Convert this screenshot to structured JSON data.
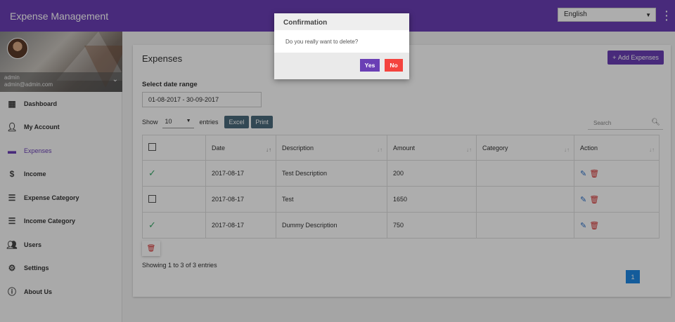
{
  "app": {
    "title": "Expense Management"
  },
  "header": {
    "language": "English"
  },
  "profile": {
    "name": "admin",
    "email": "admin@admin.com"
  },
  "sidebar": {
    "items": [
      {
        "label": "Dashboard",
        "icon": "dashboard-icon"
      },
      {
        "label": "My Account",
        "icon": "person-icon"
      },
      {
        "label": "Expenses",
        "icon": "card-icon",
        "active": true
      },
      {
        "label": "Income",
        "icon": "dollar-icon"
      },
      {
        "label": "Expense Category",
        "icon": "list-icon"
      },
      {
        "label": "Income Category",
        "icon": "list-icon"
      },
      {
        "label": "Users",
        "icon": "users-icon"
      },
      {
        "label": "Settings",
        "icon": "settings-icon"
      },
      {
        "label": "About Us",
        "icon": "info-icon"
      }
    ]
  },
  "main": {
    "title": "Expenses",
    "add_button": "Add Expenses",
    "date_label": "Select date range",
    "date_value": "01-08-2017 - 30-09-2017",
    "show_label": "Show",
    "entries_value": "10",
    "entries_label": "entries",
    "excel_label": "Excel",
    "print_label": "Print",
    "search_placeholder": "Search",
    "table": {
      "headers": [
        "Date",
        "Description",
        "Amount",
        "Category",
        "Action"
      ],
      "rows": [
        {
          "checked": true,
          "date": "2017-08-17",
          "description": "Test Description",
          "amount": "200",
          "category": ""
        },
        {
          "checked": false,
          "date": "2017-08-17",
          "description": "Test",
          "amount": "1650",
          "category": ""
        },
        {
          "checked": true,
          "date": "2017-08-17",
          "description": "Dummy Description",
          "amount": "750",
          "category": ""
        }
      ]
    },
    "info": "Showing 1 to 3 of 3 entries",
    "page": "1"
  },
  "dialog": {
    "title": "Confirmation",
    "message": "Do you really want to delete?",
    "yes": "Yes",
    "no": "No"
  },
  "colors": {
    "primary": "#6a3fb5",
    "danger": "#f4433e",
    "success": "#3aaa6a",
    "pagination": "#1e88e5"
  }
}
